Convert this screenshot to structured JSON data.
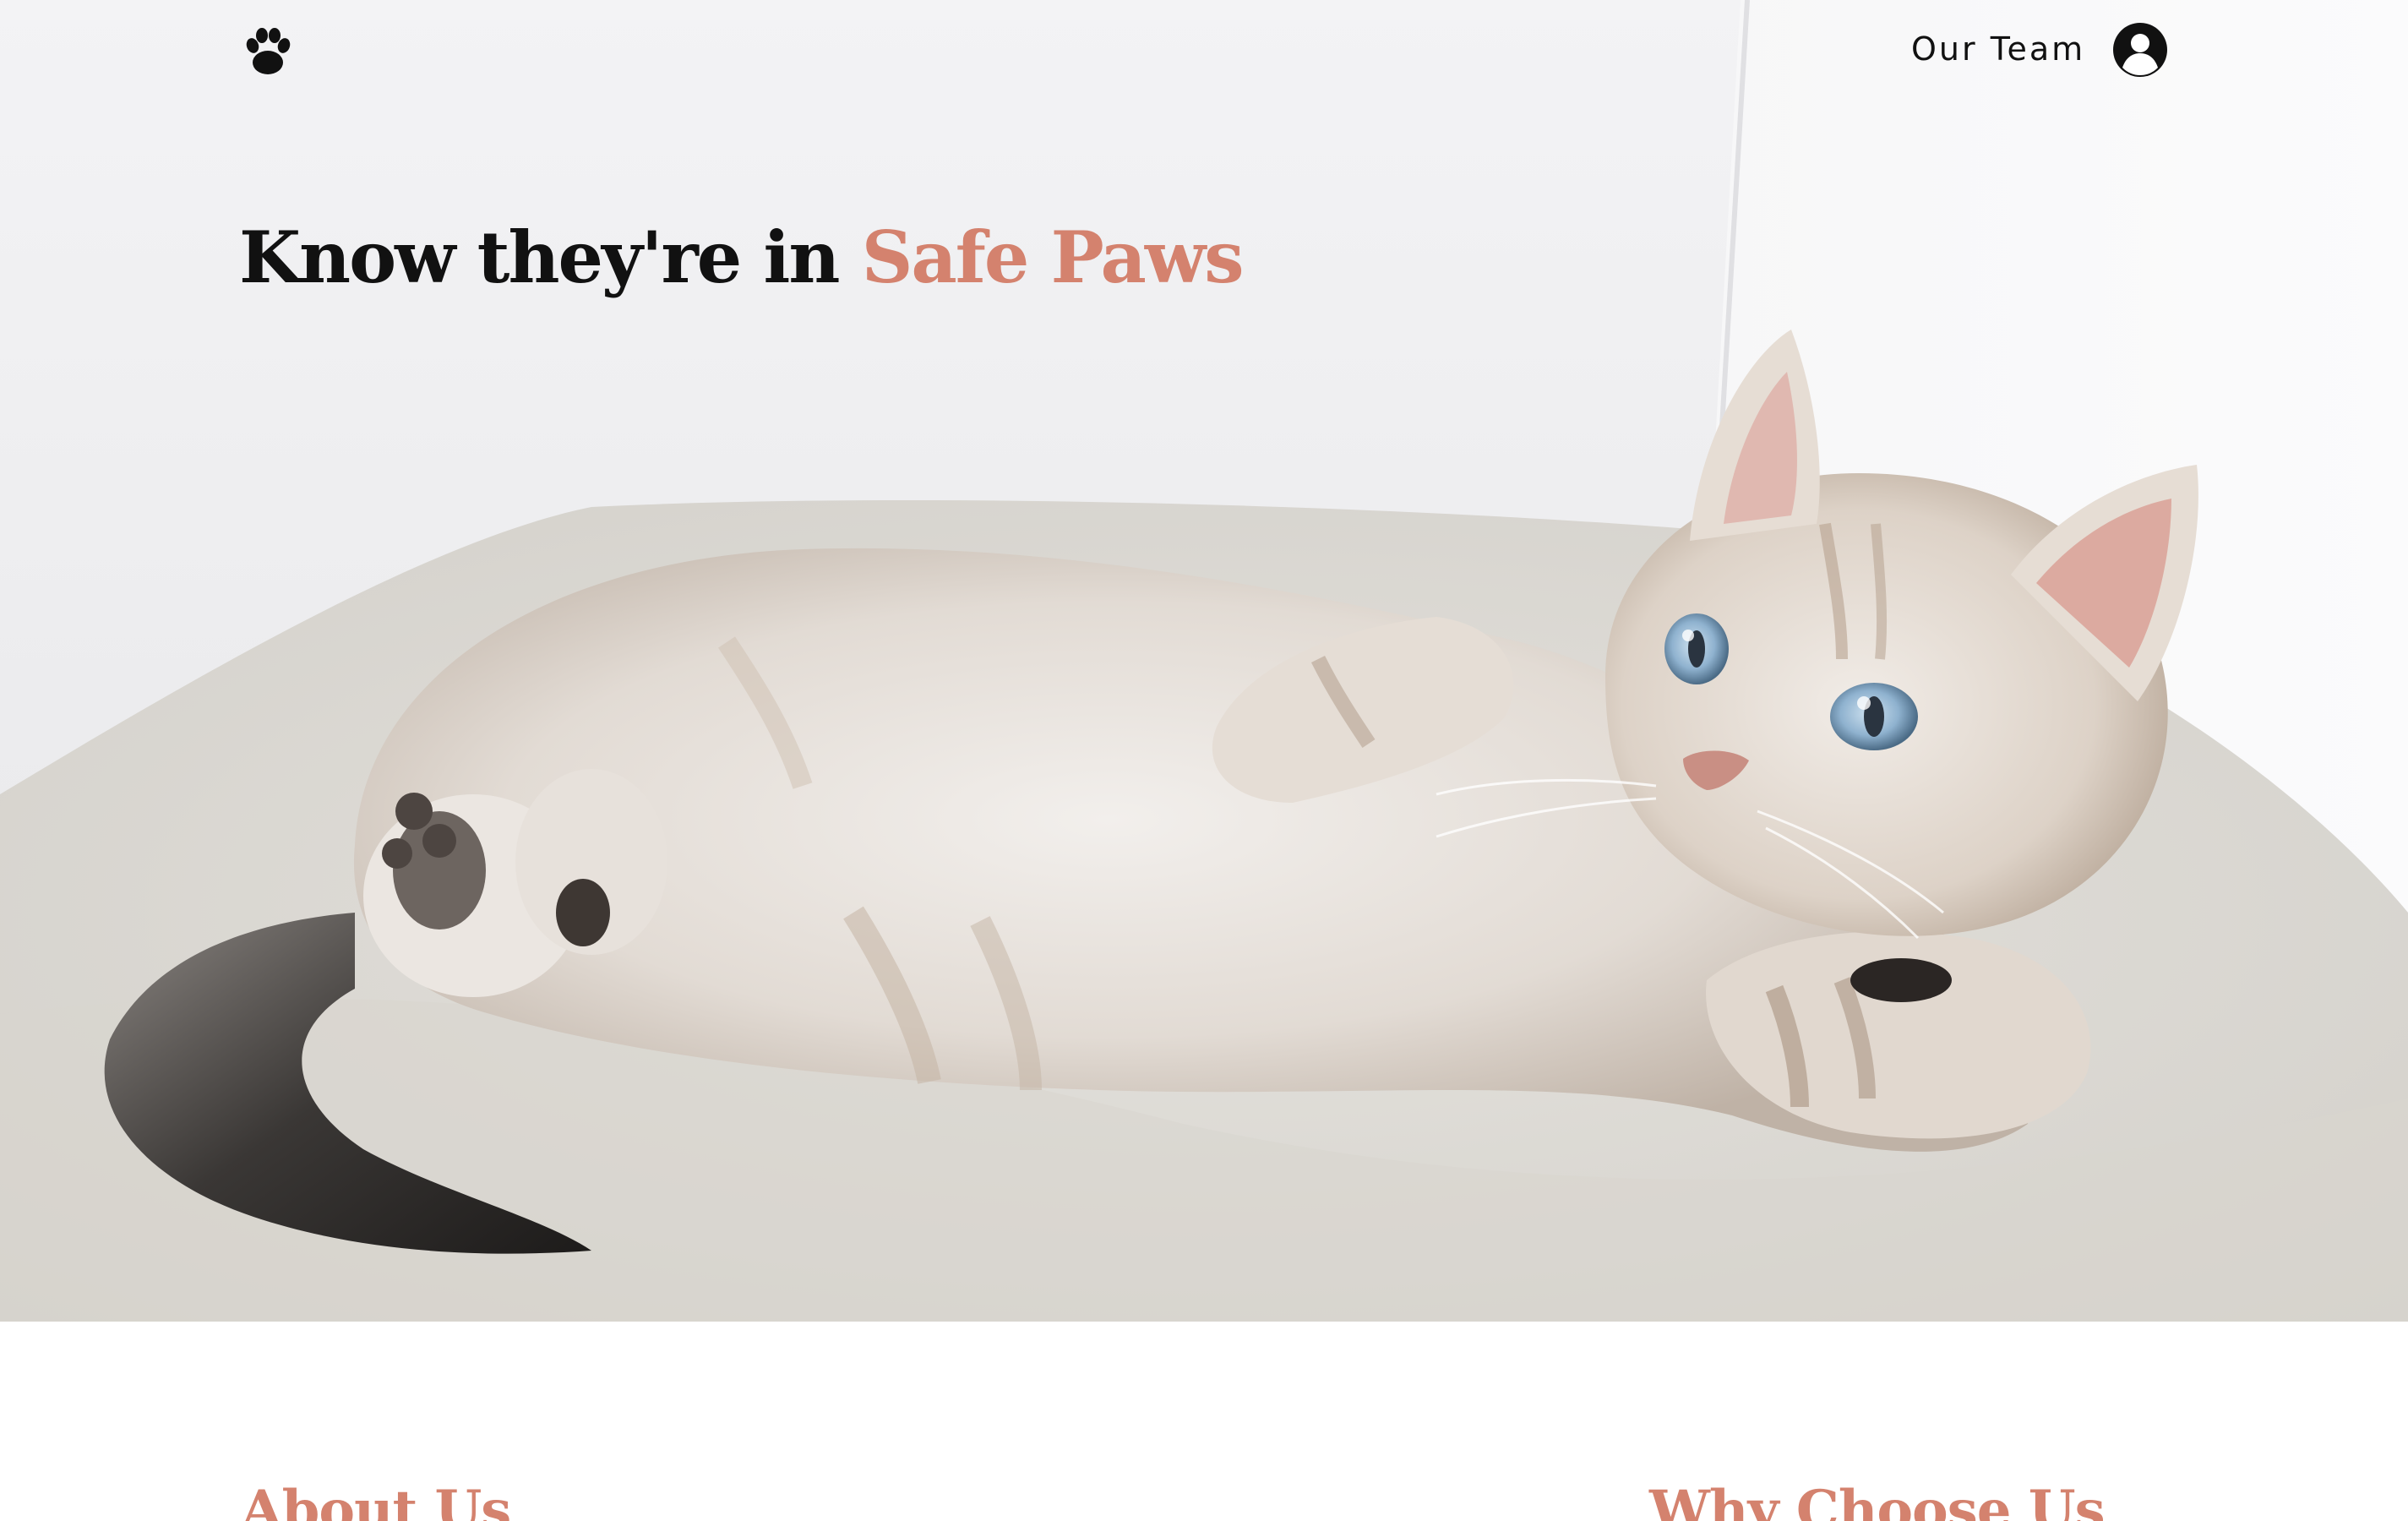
{
  "nav": {
    "logo_icon": "paw-icon",
    "our_team_label": "Our Team",
    "account_icon": "user-circle-icon"
  },
  "hero": {
    "headline_main": "Know they're in ",
    "headline_accent": "Safe Paws",
    "image_description_icon": "kitten-photo"
  },
  "sections": {
    "about_title": "About Us",
    "why_title": "Why Choose Us"
  },
  "colors": {
    "accent": "#d4826e",
    "text": "#111111",
    "background": "#ffffff"
  }
}
